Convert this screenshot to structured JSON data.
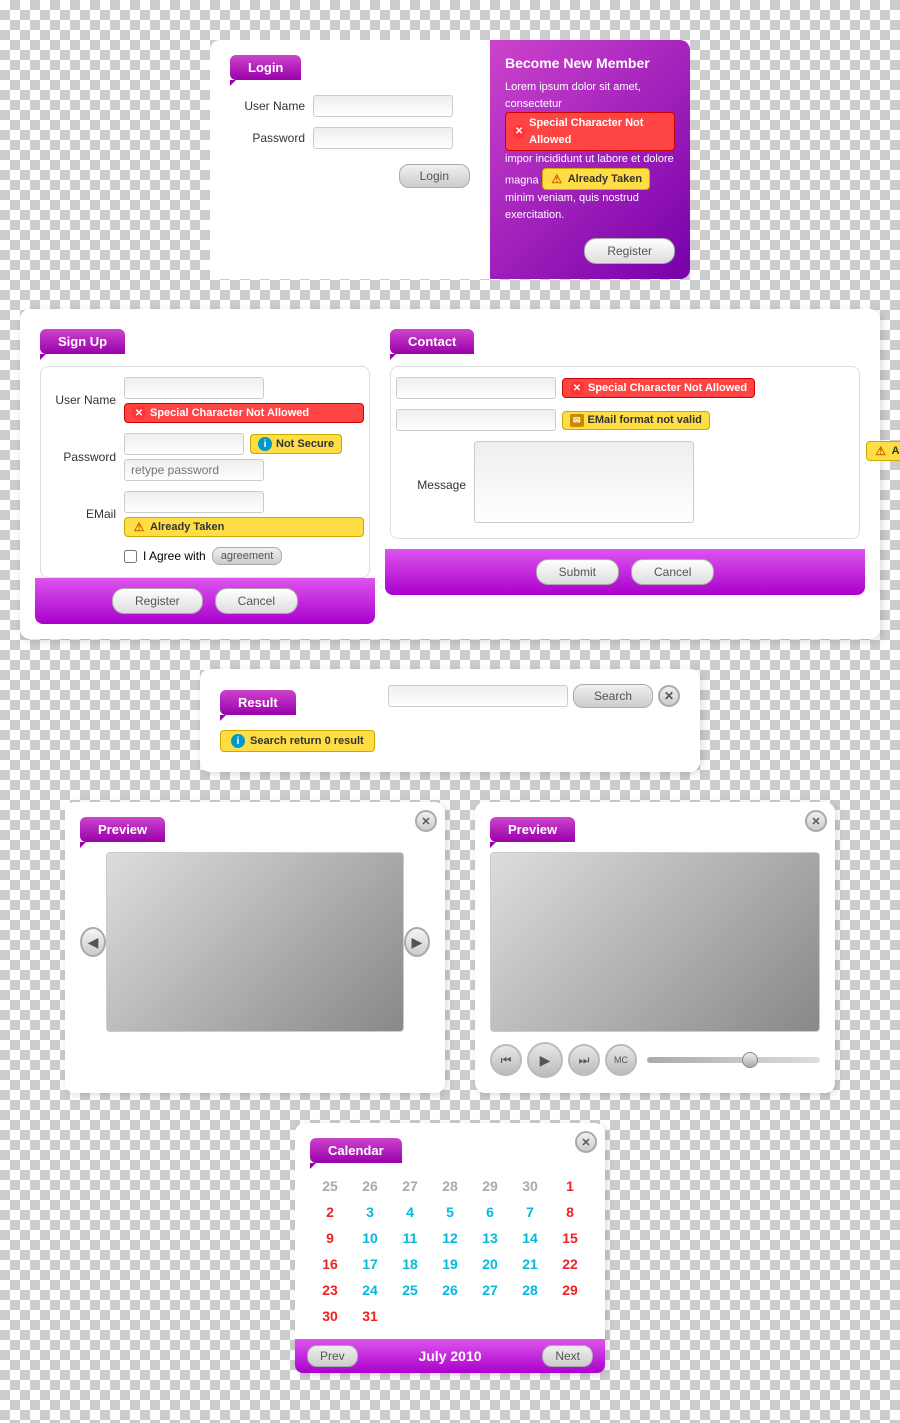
{
  "login": {
    "tab_label": "Login",
    "username_label": "User Name",
    "password_label": "Password",
    "login_btn": "Login",
    "register_btn": "Register",
    "become_member_title": "Become New Member",
    "lorem_text": "Lorem ipsum dolor sit amet, consectetur impor incididunt ut labore et dolore magna minim veniam, quis nostrud exercitation.",
    "special_char_error": "Special Character Not Allowed",
    "already_taken_error": "Already Taken"
  },
  "signup": {
    "tab_label": "Sign Up",
    "username_label": "User Name",
    "password_label": "Password",
    "retype_placeholder": "retype password",
    "email_label": "EMail",
    "agree_label": "I Agree with",
    "agreement_link": "agreement",
    "register_btn": "Register",
    "cancel_btn": "Cancel",
    "special_char_error": "Special Character Not Allowed",
    "not_secure_error": "Not Secure",
    "already_taken_error": "Already Taken"
  },
  "contact": {
    "tab_label": "Contact",
    "message_label": "Message",
    "submit_btn": "Submit",
    "cancel_btn": "Cancel",
    "special_char_error": "Special Character Not Allowed",
    "email_format_error": "EMail format not valid",
    "already_taken_error": "Already Taken"
  },
  "search": {
    "tab_label": "Result",
    "search_btn": "Search",
    "result_msg": "Search return 0 result",
    "placeholder": ""
  },
  "preview_left": {
    "tab_label": "Preview"
  },
  "preview_right": {
    "tab_label": "Preview"
  },
  "calendar": {
    "tab_label": "Calendar",
    "month_label": "July 2010",
    "prev_btn": "Prev",
    "next_btn": "Next",
    "week_rows": [
      [
        "25",
        "26",
        "27",
        "28",
        "29",
        "30",
        "1"
      ],
      [
        "2",
        "3",
        "4",
        "5",
        "6",
        "7",
        "8"
      ],
      [
        "9",
        "10",
        "11",
        "12",
        "13",
        "14",
        "15"
      ],
      [
        "16",
        "17",
        "18",
        "19",
        "20",
        "21",
        "22"
      ],
      [
        "23",
        "24",
        "25",
        "26",
        "27",
        "28",
        "29"
      ],
      [
        "30",
        "31",
        "",
        "",
        "",
        "",
        ""
      ]
    ],
    "week_colors": [
      [
        "gray",
        "gray",
        "gray",
        "gray",
        "gray",
        "gray",
        "red"
      ],
      [
        "red",
        "cyan",
        "cyan",
        "cyan",
        "cyan",
        "cyan",
        "red"
      ],
      [
        "red",
        "cyan",
        "cyan",
        "cyan",
        "cyan",
        "cyan",
        "red"
      ],
      [
        "red",
        "cyan",
        "cyan",
        "cyan",
        "cyan",
        "cyan",
        "red"
      ],
      [
        "red",
        "cyan",
        "cyan",
        "cyan",
        "cyan",
        "cyan",
        "red"
      ],
      [
        "red",
        "red",
        "",
        "",
        "",
        "",
        ""
      ]
    ]
  }
}
